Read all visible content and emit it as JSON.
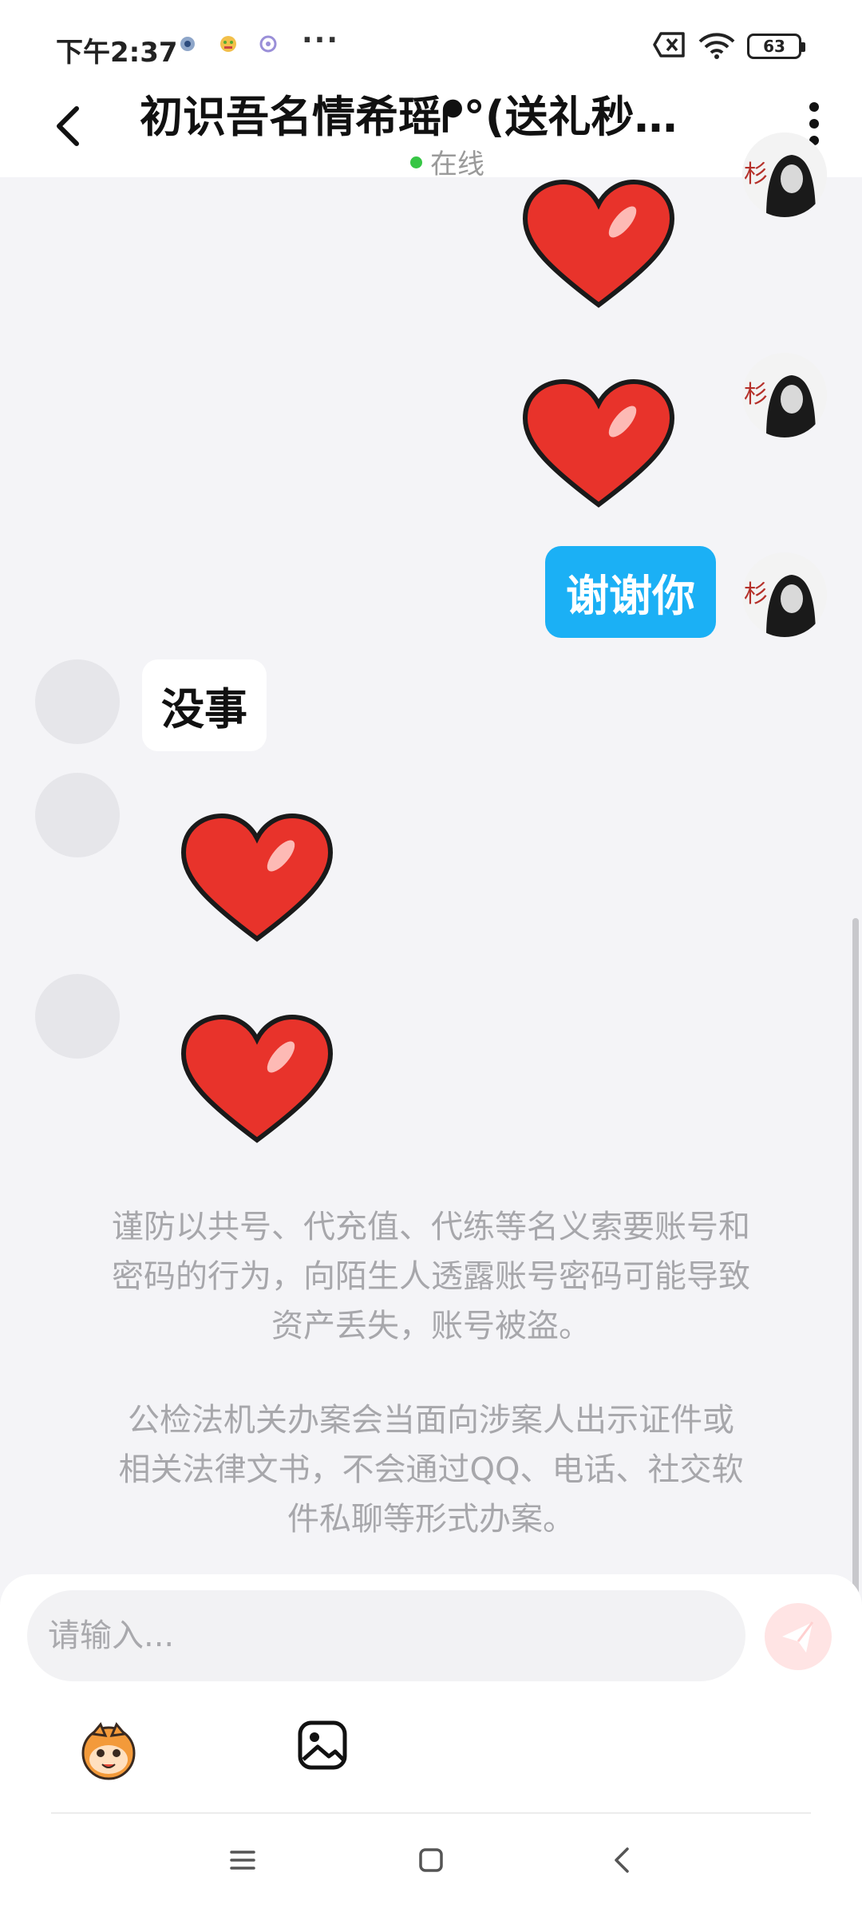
{
  "status_bar": {
    "time": "下午2:37",
    "battery": "63"
  },
  "header": {
    "title": "初识吾名情希瑶ᖰ°(送礼秒…",
    "status": "在线"
  },
  "messages": {
    "me_text": "谢谢你",
    "other_text": "没事"
  },
  "notices": {
    "line1": "谨防以共号、代充值、代练等名义索要账号和",
    "line2": "密码的行为，向陌生人透露账号密码可能导致",
    "line3": "资产丢失，账号被盗。",
    "line4": "公检法机关办案会当面向涉案人出示证件或",
    "line5": "相关法律文书，不会通过QQ、电话、社交软",
    "line6": "件私聊等形式办案。"
  },
  "input": {
    "placeholder": "请输入..."
  },
  "colors": {
    "accent": "#1bb0f5",
    "online": "#37c645",
    "heart": "#e8332b",
    "send": "#ffe4e4"
  },
  "icons": [
    "back-icon",
    "more-icon",
    "heart-sticker",
    "send-icon",
    "emoji-icon",
    "image-icon",
    "menu-icon",
    "home-icon",
    "nav-back-icon"
  ]
}
